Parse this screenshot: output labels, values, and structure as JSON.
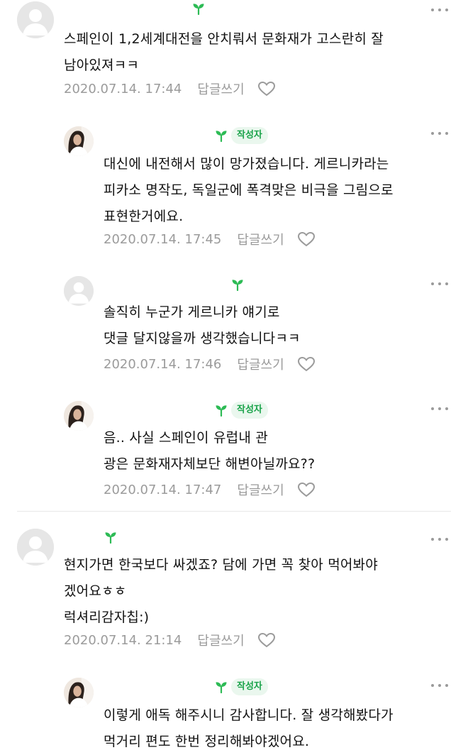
{
  "comments": [
    {
      "text": "스페인이 1,2세계대전을 안치뤄서 문화재가 고스란히 잘\n남아있져ㅋㅋ",
      "date": "2020.07.14. 17:44",
      "reply_label": "답글쓰기",
      "avatar": "default"
    },
    {
      "badge": "작성자",
      "text": "대신에 내전해서 많이 망가졌습니다. 게르니카라는\n피카소 명작도, 독일군에 폭격맞은 비극을 그림으로\n표현한거에요.",
      "date": "2020.07.14. 17:45",
      "reply_label": "답글쓰기",
      "avatar": "photo"
    },
    {
      "text": "솔직히 누군가 게르니카 얘기로\n댓글 달지않을까 생각했습니다ㅋㅋ",
      "date": "2020.07.14. 17:46",
      "reply_label": "답글쓰기",
      "avatar": "default"
    },
    {
      "badge": "작성자",
      "text": "음.. 사실 스페인이 유럽내 관\n광은 문화재자체보단 해변아닐까요??",
      "date": "2020.07.14. 17:47",
      "reply_label": "답글쓰기",
      "avatar": "photo"
    },
    {
      "text": "현지가면 한국보다 싸겠죠? 담에 가면 꼭 찾아 먹어봐야\n겠어요ㅎㅎ\n럭셔리감자칩:)",
      "date": "2020.07.14. 21:14",
      "reply_label": "답글쓰기",
      "avatar": "default"
    },
    {
      "badge": "작성자",
      "text": "이렇게 애독 해주시니 감사합니다. 잘 생각해봤다가\n먹거리 편도 한번 정리해봐야겠어요.",
      "date": "",
      "reply_label": "",
      "avatar": "photo"
    }
  ],
  "colors": {
    "badge_bg": "#eaf7ee",
    "badge_text": "#1aa34a",
    "sprout": "#2dbb55",
    "meta": "#9b9b9b"
  }
}
